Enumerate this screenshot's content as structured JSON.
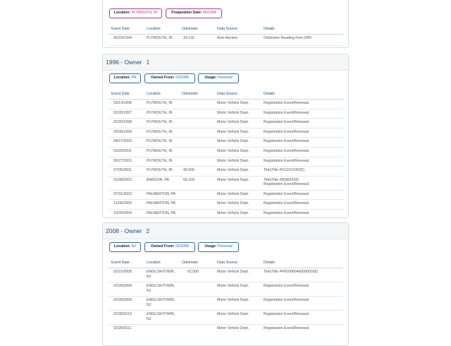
{
  "columns": [
    "Event Date",
    "Location",
    "Odometer",
    "Data Source",
    "Details"
  ],
  "top_section": {
    "badges": [
      {
        "label": "Location:",
        "value": "PLYMOUTH, IN"
      },
      {
        "label": "Preparation Date:",
        "value": "06/1994"
      }
    ],
    "rows": [
      {
        "date": "06/23/1994",
        "location": "PLYMOUTH, IN",
        "odometer": "39,116",
        "source": "Auto Auction",
        "details": "Odometer Reading from DMV"
      }
    ]
  },
  "owner1": {
    "year": "1996 - Owner",
    "num": "1",
    "badges": [
      {
        "label": "Location:",
        "value": "PA"
      },
      {
        "label": "Owned From:",
        "value": "03/1996"
      },
      {
        "label": "Usage:",
        "value": "Personal"
      }
    ],
    "rows": [
      {
        "date": "03/14/1996",
        "location": "PLYMOUTH, IN",
        "odometer": "",
        "source": "Motor Vehicle Dept.",
        "details": "Registration Event/Renewal"
      },
      {
        "date": "02/20/1997",
        "location": "PLYMOUTH, IN",
        "odometer": "",
        "source": "Motor Vehicle Dept.",
        "details": "Registration Event/Renewal"
      },
      {
        "date": "02/20/1998",
        "location": "PLYMOUTH, IN",
        "odometer": "",
        "source": "Motor Vehicle Dept.",
        "details": "Registration Event/Renewal"
      },
      {
        "date": "02/08/1999",
        "location": "PLYMOUTH, IN",
        "odometer": "",
        "source": "Motor Vehicle Dept.",
        "details": "Registration Event/Renewal"
      },
      {
        "date": "04/27/2000",
        "location": "PLYMOUTH, IN",
        "odometer": "",
        "source": "Motor Vehicle Dept.",
        "details": "Registration Event/Renewal"
      },
      {
        "date": "03/29/2001",
        "location": "PLYMOUTH, IN",
        "odometer": "",
        "source": "Motor Vehicle Dept.",
        "details": "Registration Event/Renewal"
      },
      {
        "date": "06/27/2001",
        "location": "PLYMOUTH, IN",
        "odometer": "",
        "source": "Motor Vehicle Dept.",
        "details": "Registration Event/Renewal"
      },
      {
        "date": "07/05/2001",
        "location": "PLYMOUTH, IN",
        "odometer": "49,000",
        "source": "Motor Vehicle Dept.",
        "details": "Title(Title #01116124025)"
      },
      {
        "date": "01/08/2002",
        "location": "BANGOR, PA",
        "odometer": "58,159",
        "source": "Motor Vehicle Dept.",
        "details": "Title(Title #56983343)",
        "details2": "Registration Event/Renewal"
      },
      {
        "date": "07/31/2002",
        "location": "PALMERTON, PA",
        "odometer": "",
        "source": "Motor Vehicle Dept.",
        "details": "Registration Event/Renewal"
      },
      {
        "date": "11/06/2003",
        "location": "PALMERTON, PA",
        "odometer": "",
        "source": "Motor Vehicle Dept.",
        "details": "Registration Event/Renewal"
      },
      {
        "date": "10/26/2004",
        "location": "PALMERTON, PA",
        "odometer": "",
        "source": "Motor Vehicle Dept.",
        "details": "Registration Event/Renewal"
      }
    ]
  },
  "owner2": {
    "year": "2008 - Owner",
    "num": "2",
    "badges": [
      {
        "label": "Location:",
        "value": "NJ"
      },
      {
        "label": "Owned From:",
        "value": "02/2008"
      },
      {
        "label": "Usage:",
        "value": "Personal"
      }
    ],
    "rows": [
      {
        "date": "02/15/2008",
        "location": "ENGLISHTOWN,",
        "location2": "NJ",
        "odometer": "62,000",
        "source": "Motor Vehicle Dept.",
        "details": "Title(Title #FR200804600000305)"
      },
      {
        "date": "02/28/2008",
        "location": "ENGLISHTOWN,",
        "location2": "NJ",
        "odometer": "",
        "source": "Motor Vehicle Dept.",
        "details": "Registration Event/Renewal"
      },
      {
        "date": "02/28/2009",
        "location": "ENGLISHTOWN,",
        "location2": "NJ",
        "odometer": "",
        "source": "Motor Vehicle Dept.",
        "details": "Registration Event/Renewal"
      },
      {
        "date": "02/28/2010",
        "location": "ENGLISHTOWN,",
        "location2": "NJ",
        "odometer": "",
        "source": "Motor Vehicle Dept.",
        "details": "Registration Event/Renewal"
      },
      {
        "date": "02/28/2011",
        "location": "",
        "odometer": "",
        "source": "Motor Vehicle Dept.",
        "details": "Registration Event/Renewal"
      }
    ]
  }
}
